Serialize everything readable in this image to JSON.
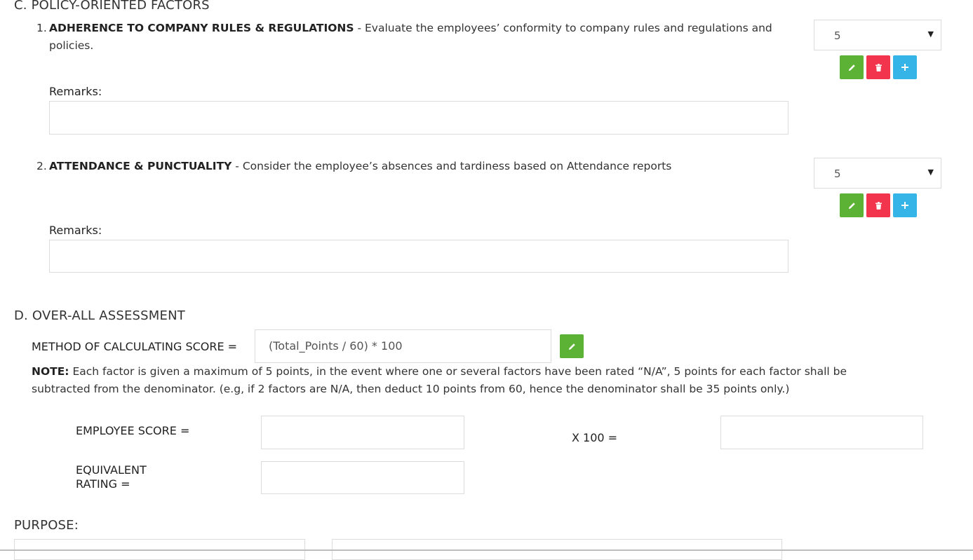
{
  "sectionC": {
    "title": "C. POLICY-ORIENTED FACTORS",
    "items": [
      {
        "number": "1.",
        "name": "ADHERENCE TO COMPANY RULES & REGULATIONS",
        "description": " - Evaluate the employees’ conformity to company rules and regulations and policies.",
        "rating": "5",
        "remarks_label": "Remarks:",
        "remarks_value": ""
      },
      {
        "number": "2.",
        "name": "ATTENDANCE & PUNCTUALITY",
        "description": " - Consider the employee’s absences and tardiness based on Attendance reports",
        "rating": "5",
        "remarks_label": "Remarks:",
        "remarks_value": ""
      }
    ]
  },
  "sectionD": {
    "title": "D. OVER-ALL ASSESSMENT",
    "method_label": "METHOD OF CALCULATING SCORE =",
    "method_value": "(Total_Points / 60) * 100",
    "note_label": "NOTE:",
    "note_text": " Each factor is given a maximum of 5 points, in the event where one or several factors have been rated “N/A”, 5 points for each factor shall be subtracted from the denominator. (e.g, if 2 factors are N/A, then deduct 10 points from 60, hence the denominator shall be 35 points only.)",
    "employee_score_label": "EMPLOYEE SCORE =",
    "x100_label": "X 100 =",
    "equivalent_rating_label": "EQUIVALENT RATING ="
  },
  "purpose": {
    "title": "PURPOSE:"
  },
  "icons": {
    "edit": "pencil-icon",
    "delete": "trash-icon",
    "add": "plus-icon"
  },
  "colors": {
    "edit_button": "#5cb234",
    "delete_button": "#f2344c",
    "add_button": "#35b4e8"
  }
}
